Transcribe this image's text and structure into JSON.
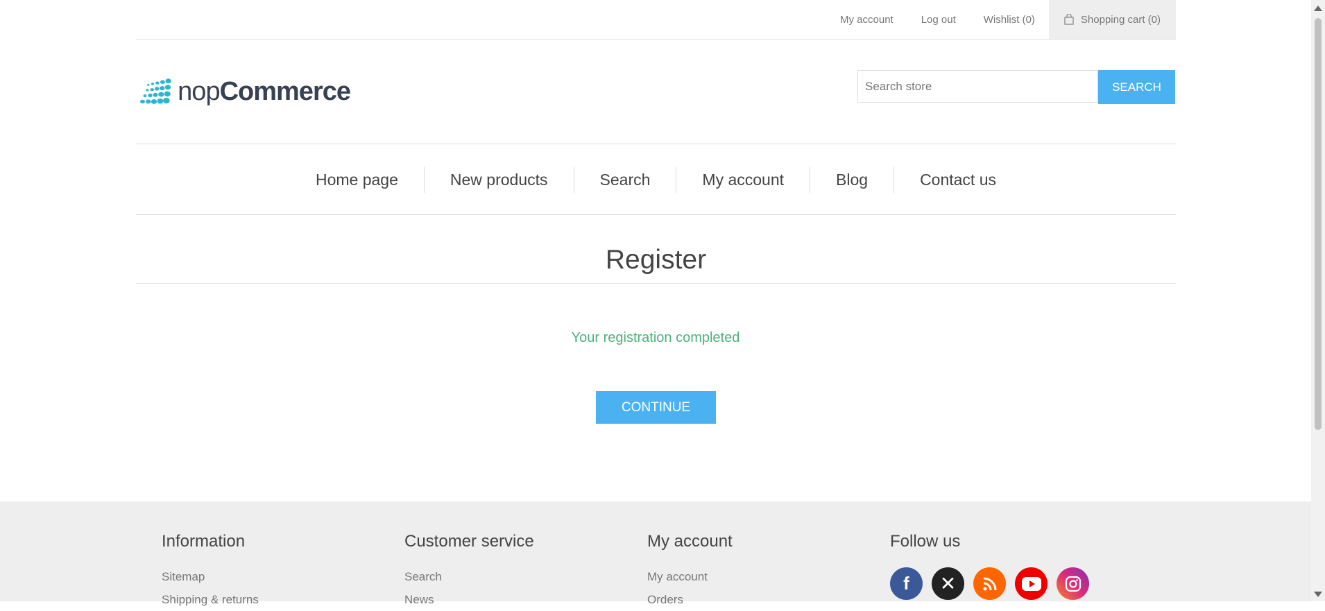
{
  "header": {
    "links": [
      {
        "label": "My account"
      },
      {
        "label": "Log out"
      },
      {
        "label": "Wishlist (0)"
      },
      {
        "label": "Shopping cart (0)"
      }
    ]
  },
  "logo": {
    "prefix": "nop",
    "brand": "Commerce",
    "icon": "nopcommerce-dots-logo"
  },
  "search": {
    "placeholder": "Search store",
    "button_label": "SEARCH"
  },
  "menu": {
    "items": [
      "Home page",
      "New products",
      "Search",
      "My account",
      "Blog",
      "Contact us"
    ]
  },
  "page": {
    "title": "Register",
    "result": "Your registration completed",
    "continue_label": "CONTINUE"
  },
  "footer": {
    "columns": [
      {
        "title": "Information",
        "items": [
          "Sitemap",
          "Shipping & returns"
        ]
      },
      {
        "title": "Customer service",
        "items": [
          "Search",
          "News"
        ]
      },
      {
        "title": "My account",
        "items": [
          "My account",
          "Orders"
        ]
      }
    ],
    "follow": {
      "title": "Follow us",
      "icons": [
        {
          "name": "facebook-icon",
          "glyph": "f",
          "color": "#3b5998"
        },
        {
          "name": "x-icon",
          "glyph": "𝕏",
          "color": "#222222"
        },
        {
          "name": "rss-icon",
          "glyph": "☰",
          "color": "#ff6600"
        },
        {
          "name": "youtube-icon",
          "glyph": "▶",
          "color": "#ee0000"
        },
        {
          "name": "instagram-icon",
          "glyph": "◎",
          "color": "#c13584"
        }
      ]
    }
  },
  "colors": {
    "accent": "#4ab2f1",
    "success": "#4cb17c"
  }
}
